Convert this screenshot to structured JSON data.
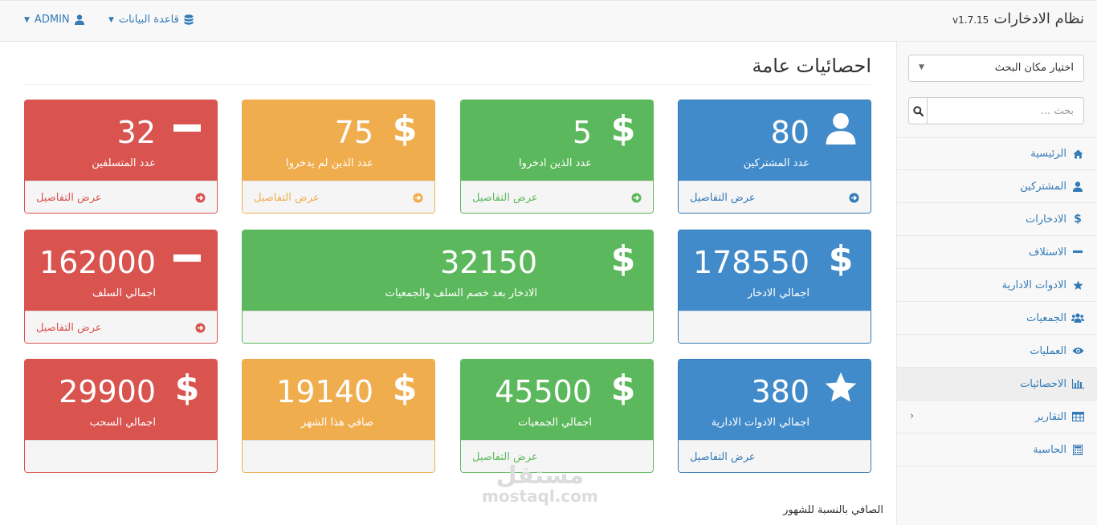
{
  "navbar": {
    "brand": "نظام الادخارات",
    "version": "v1.7.15",
    "db_menu": "قاعدة البيانات",
    "admin_menu": "ADMIN"
  },
  "sidebar": {
    "select_label": "اختيار مكان البحث",
    "search_placeholder": "بحث ...",
    "items": [
      {
        "label": "الرئيسية",
        "icon": "home-icon"
      },
      {
        "label": "المشتركين",
        "icon": "user-icon"
      },
      {
        "label": "الادخارات",
        "icon": "dollar-icon"
      },
      {
        "label": "الاستلاف",
        "icon": "minus-icon"
      },
      {
        "label": "الادوات الادارية",
        "icon": "star-icon"
      },
      {
        "label": "الجمعيات",
        "icon": "users-icon"
      },
      {
        "label": "العمليات",
        "icon": "eye-icon"
      },
      {
        "label": "الاحصائيات",
        "icon": "bar-chart-icon"
      },
      {
        "label": "التقارير",
        "icon": "table-icon"
      },
      {
        "label": "الحاسبة",
        "icon": "calculator-icon"
      }
    ],
    "active_index": 7
  },
  "main": {
    "title": "احصائيات عامة",
    "details_label": "عرض التفاصيل",
    "panels": [
      {
        "value": "80",
        "label": "عدد المشتركين",
        "color": "blue",
        "icon": "user-icon"
      },
      {
        "value": "5",
        "label": "عدد الذين ادخروا",
        "color": "green",
        "icon": "dollar-icon"
      },
      {
        "value": "75",
        "label": "عدد الذين لم يدخروا",
        "color": "yellow",
        "icon": "dollar-icon"
      },
      {
        "value": "32",
        "label": "عدد المتسلفين",
        "color": "red",
        "icon": "minus-icon"
      },
      {
        "value": "178550",
        "label": "اجمالي الادخار",
        "color": "blue",
        "icon": "dollar-icon"
      },
      {
        "value": "32150",
        "label": "الادخار بعد خصم السلف والجمعيات",
        "color": "green",
        "icon": "dollar-icon"
      },
      {
        "value": "162000",
        "label": "اجمالي السلف",
        "color": "red",
        "icon": "minus-icon"
      },
      {
        "value": "380",
        "label": "اجمالي الادوات الادارية",
        "color": "blue",
        "icon": "star-icon"
      },
      {
        "value": "45500",
        "label": "اجمالي الجمعيات",
        "color": "green",
        "icon": "dollar-icon"
      },
      {
        "value": "19140",
        "label": "صافي هذا الشهر",
        "color": "yellow",
        "icon": "dollar-icon"
      },
      {
        "value": "29900",
        "label": "اجمالي السحب",
        "color": "red",
        "icon": "dollar-icon"
      }
    ],
    "bottom_text": "الصافي بالنسبة للشهور"
  },
  "watermark": {
    "arabic": "مستقل",
    "latin": "mostaql.com"
  },
  "colors": {
    "blue": "#428bca",
    "green": "#5cb85c",
    "yellow": "#f0ad4e",
    "red": "#d9534f",
    "link": "#337ab7"
  }
}
